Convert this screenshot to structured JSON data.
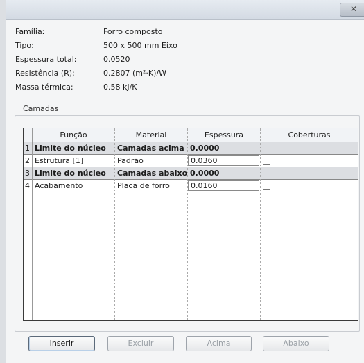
{
  "window": {
    "close_glyph": "✕"
  },
  "properties": [
    {
      "label": "Família:",
      "value": "Forro composto"
    },
    {
      "label": "Tipo:",
      "value": "500 x 500 mm Eixo"
    },
    {
      "label": "Espessura total:",
      "value": "0.0520"
    },
    {
      "label": "Resistência (R):",
      "value": "0.2807 (m²·K)/W"
    },
    {
      "label": "Massa térmica:",
      "value": "0.58 kJ/K"
    }
  ],
  "layers_group": {
    "label": "Camadas",
    "columns": [
      "Função",
      "Material",
      "Espessura",
      "Coberturas"
    ],
    "rows": [
      {
        "num": "1",
        "funcao": "Limite do núcleo",
        "material": "Camadas acima",
        "espessura": "0.0000",
        "shaded": true,
        "bold": true,
        "checkbox": false
      },
      {
        "num": "2",
        "funcao": "Estrutura [1]",
        "material": "Padrão",
        "espessura": "0.0360",
        "shaded": false,
        "bold": false,
        "checkbox": true
      },
      {
        "num": "3",
        "funcao": "Limite do núcleo",
        "material": "Camadas abaixo",
        "espessura": "0.0000",
        "shaded": true,
        "bold": true,
        "checkbox": false
      },
      {
        "num": "4",
        "funcao": "Acabamento",
        "material": "Placa de forro",
        "espessura": "0.0160",
        "shaded": false,
        "bold": false,
        "checkbox": true
      }
    ]
  },
  "buttons": {
    "insert": "Inserir",
    "delete": "Excluir",
    "up": "Acima",
    "down": "Abaixo"
  }
}
